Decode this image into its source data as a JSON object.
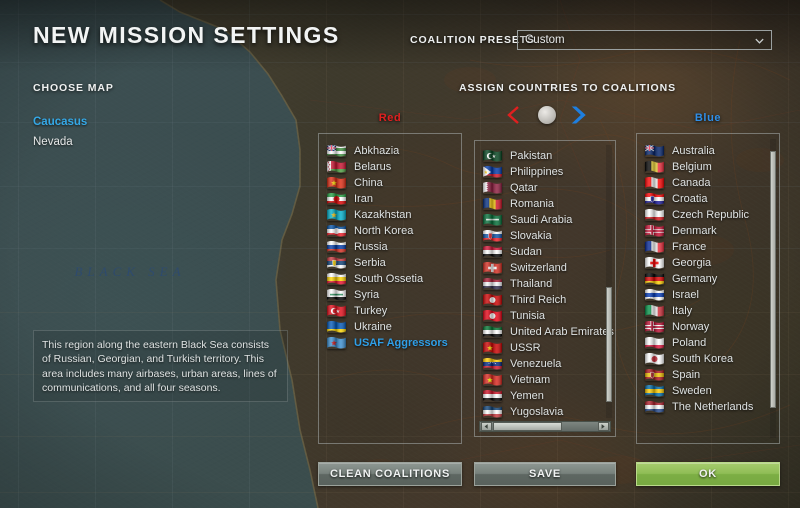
{
  "window": {
    "title": "NEW MISSION SETTINGS"
  },
  "header": {
    "presets_label": "COALITION PRESETS",
    "preset_value": "Custom",
    "preset_icon": "chevron-down-icon"
  },
  "left": {
    "choose_map_label": "CHOOSE MAP",
    "maps": [
      {
        "label": "Caucasus",
        "selected": true
      },
      {
        "label": "Nevada",
        "selected": false
      }
    ],
    "description": "This region along the eastern Black Sea consists of Russian, Georgian, and Turkish territory. This area includes many airbases, urban areas, lines of communications, and all four seasons.",
    "map_sea_label": "BLACK SEA"
  },
  "assign": {
    "heading": "ASSIGN COUNTRIES TO COALITIONS",
    "move_left_icon": "chevron-left-red-icon",
    "neutral_dot_icon": "neutral-circle-icon",
    "move_right_icon": "chevron-right-blue-icon"
  },
  "colors": {
    "red": "#e02020",
    "blue": "#2f8fe8",
    "selected_text": "#2f9fe8",
    "ok_green": "#8fbd55",
    "map_selected": "#35a8e6"
  },
  "columns": {
    "red": {
      "title": "Red",
      "countries": [
        {
          "name": "Abkhazia",
          "selected": false
        },
        {
          "name": "Belarus",
          "selected": false
        },
        {
          "name": "China",
          "selected": false
        },
        {
          "name": "Iran",
          "selected": false
        },
        {
          "name": "Kazakhstan",
          "selected": false
        },
        {
          "name": "North Korea",
          "selected": false
        },
        {
          "name": "Russia",
          "selected": false
        },
        {
          "name": "Serbia",
          "selected": false
        },
        {
          "name": "South Ossetia",
          "selected": false
        },
        {
          "name": "Syria",
          "selected": false
        },
        {
          "name": "Turkey",
          "selected": false
        },
        {
          "name": "Ukraine",
          "selected": false
        },
        {
          "name": "USAF Aggressors",
          "selected": true
        }
      ],
      "scrollbars": {
        "vertical": false,
        "horizontal": false
      }
    },
    "neutral": {
      "title": "",
      "countries": [
        {
          "name": "Pakistan",
          "selected": false
        },
        {
          "name": "Philippines",
          "selected": false
        },
        {
          "name": "Qatar",
          "selected": false
        },
        {
          "name": "Romania",
          "selected": false
        },
        {
          "name": "Saudi Arabia",
          "selected": false
        },
        {
          "name": "Slovakia",
          "selected": false
        },
        {
          "name": "Sudan",
          "selected": false
        },
        {
          "name": "Switzerland",
          "selected": false
        },
        {
          "name": "Thailand",
          "selected": false
        },
        {
          "name": "Third Reich",
          "selected": false
        },
        {
          "name": "Tunisia",
          "selected": false
        },
        {
          "name": "United Arab Emirates",
          "selected": false
        },
        {
          "name": "USSR",
          "selected": false
        },
        {
          "name": "Venezuela",
          "selected": false
        },
        {
          "name": "Vietnam",
          "selected": false
        },
        {
          "name": "Yemen",
          "selected": false
        },
        {
          "name": "Yugoslavia",
          "selected": false
        }
      ],
      "scrollbars": {
        "vertical": true,
        "horizontal": true,
        "v_thumb_pct": 52,
        "h_thumb_pct": 66
      }
    },
    "blue": {
      "title": "Blue",
      "countries": [
        {
          "name": "Australia",
          "selected": false
        },
        {
          "name": "Belgium",
          "selected": false
        },
        {
          "name": "Canada",
          "selected": false
        },
        {
          "name": "Croatia",
          "selected": false
        },
        {
          "name": "Czech Republic",
          "selected": false
        },
        {
          "name": "Denmark",
          "selected": false
        },
        {
          "name": "France",
          "selected": false
        },
        {
          "name": "Georgia",
          "selected": false
        },
        {
          "name": "Germany",
          "selected": false
        },
        {
          "name": "Israel",
          "selected": false
        },
        {
          "name": "Italy",
          "selected": false
        },
        {
          "name": "Norway",
          "selected": false
        },
        {
          "name": "Poland",
          "selected": false
        },
        {
          "name": "South Korea",
          "selected": false
        },
        {
          "name": "Spain",
          "selected": false
        },
        {
          "name": "Sweden",
          "selected": false
        },
        {
          "name": "The Netherlands",
          "selected": false
        }
      ],
      "scrollbars": {
        "vertical": true,
        "horizontal": false,
        "v_thumb_pct": 88
      }
    }
  },
  "footer": {
    "clean_label": "CLEAN COALITIONS",
    "save_label": "SAVE",
    "ok_label": "OK"
  }
}
